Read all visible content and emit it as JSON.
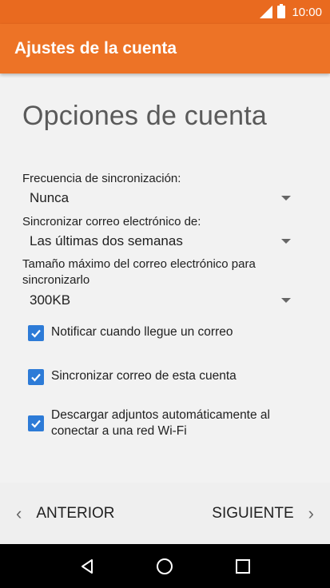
{
  "status_bar": {
    "time": "10:00"
  },
  "app_bar": {
    "title": "Ajustes de la cuenta"
  },
  "page": {
    "heading": "Opciones de cuenta"
  },
  "fields": [
    {
      "label": "Frecuencia de sincronización:",
      "value": "Nunca"
    },
    {
      "label": "Sincronizar correo electrónico de:",
      "value": "Las últimas dos semanas"
    },
    {
      "label": "Tamaño máximo del correo electrónico para sincronizarlo",
      "value": "300KB"
    }
  ],
  "checkboxes": [
    {
      "label": "Notificar cuando llegue un correo",
      "checked": true
    },
    {
      "label": "Sincronizar correo de esta cuenta",
      "checked": true
    },
    {
      "label": "Descargar adjuntos automáticamente al conectar a una red Wi-Fi",
      "checked": true
    }
  ],
  "bottom_nav": {
    "previous_label": "ANTERIOR",
    "next_label": "SIGUIENTE"
  },
  "colors": {
    "status_bar": "#e96a1f",
    "app_bar": "#ed7326",
    "checkbox": "#2d7bd7"
  },
  "system_nav": {
    "icons": [
      "back-icon",
      "home-icon",
      "recents-icon"
    ]
  }
}
